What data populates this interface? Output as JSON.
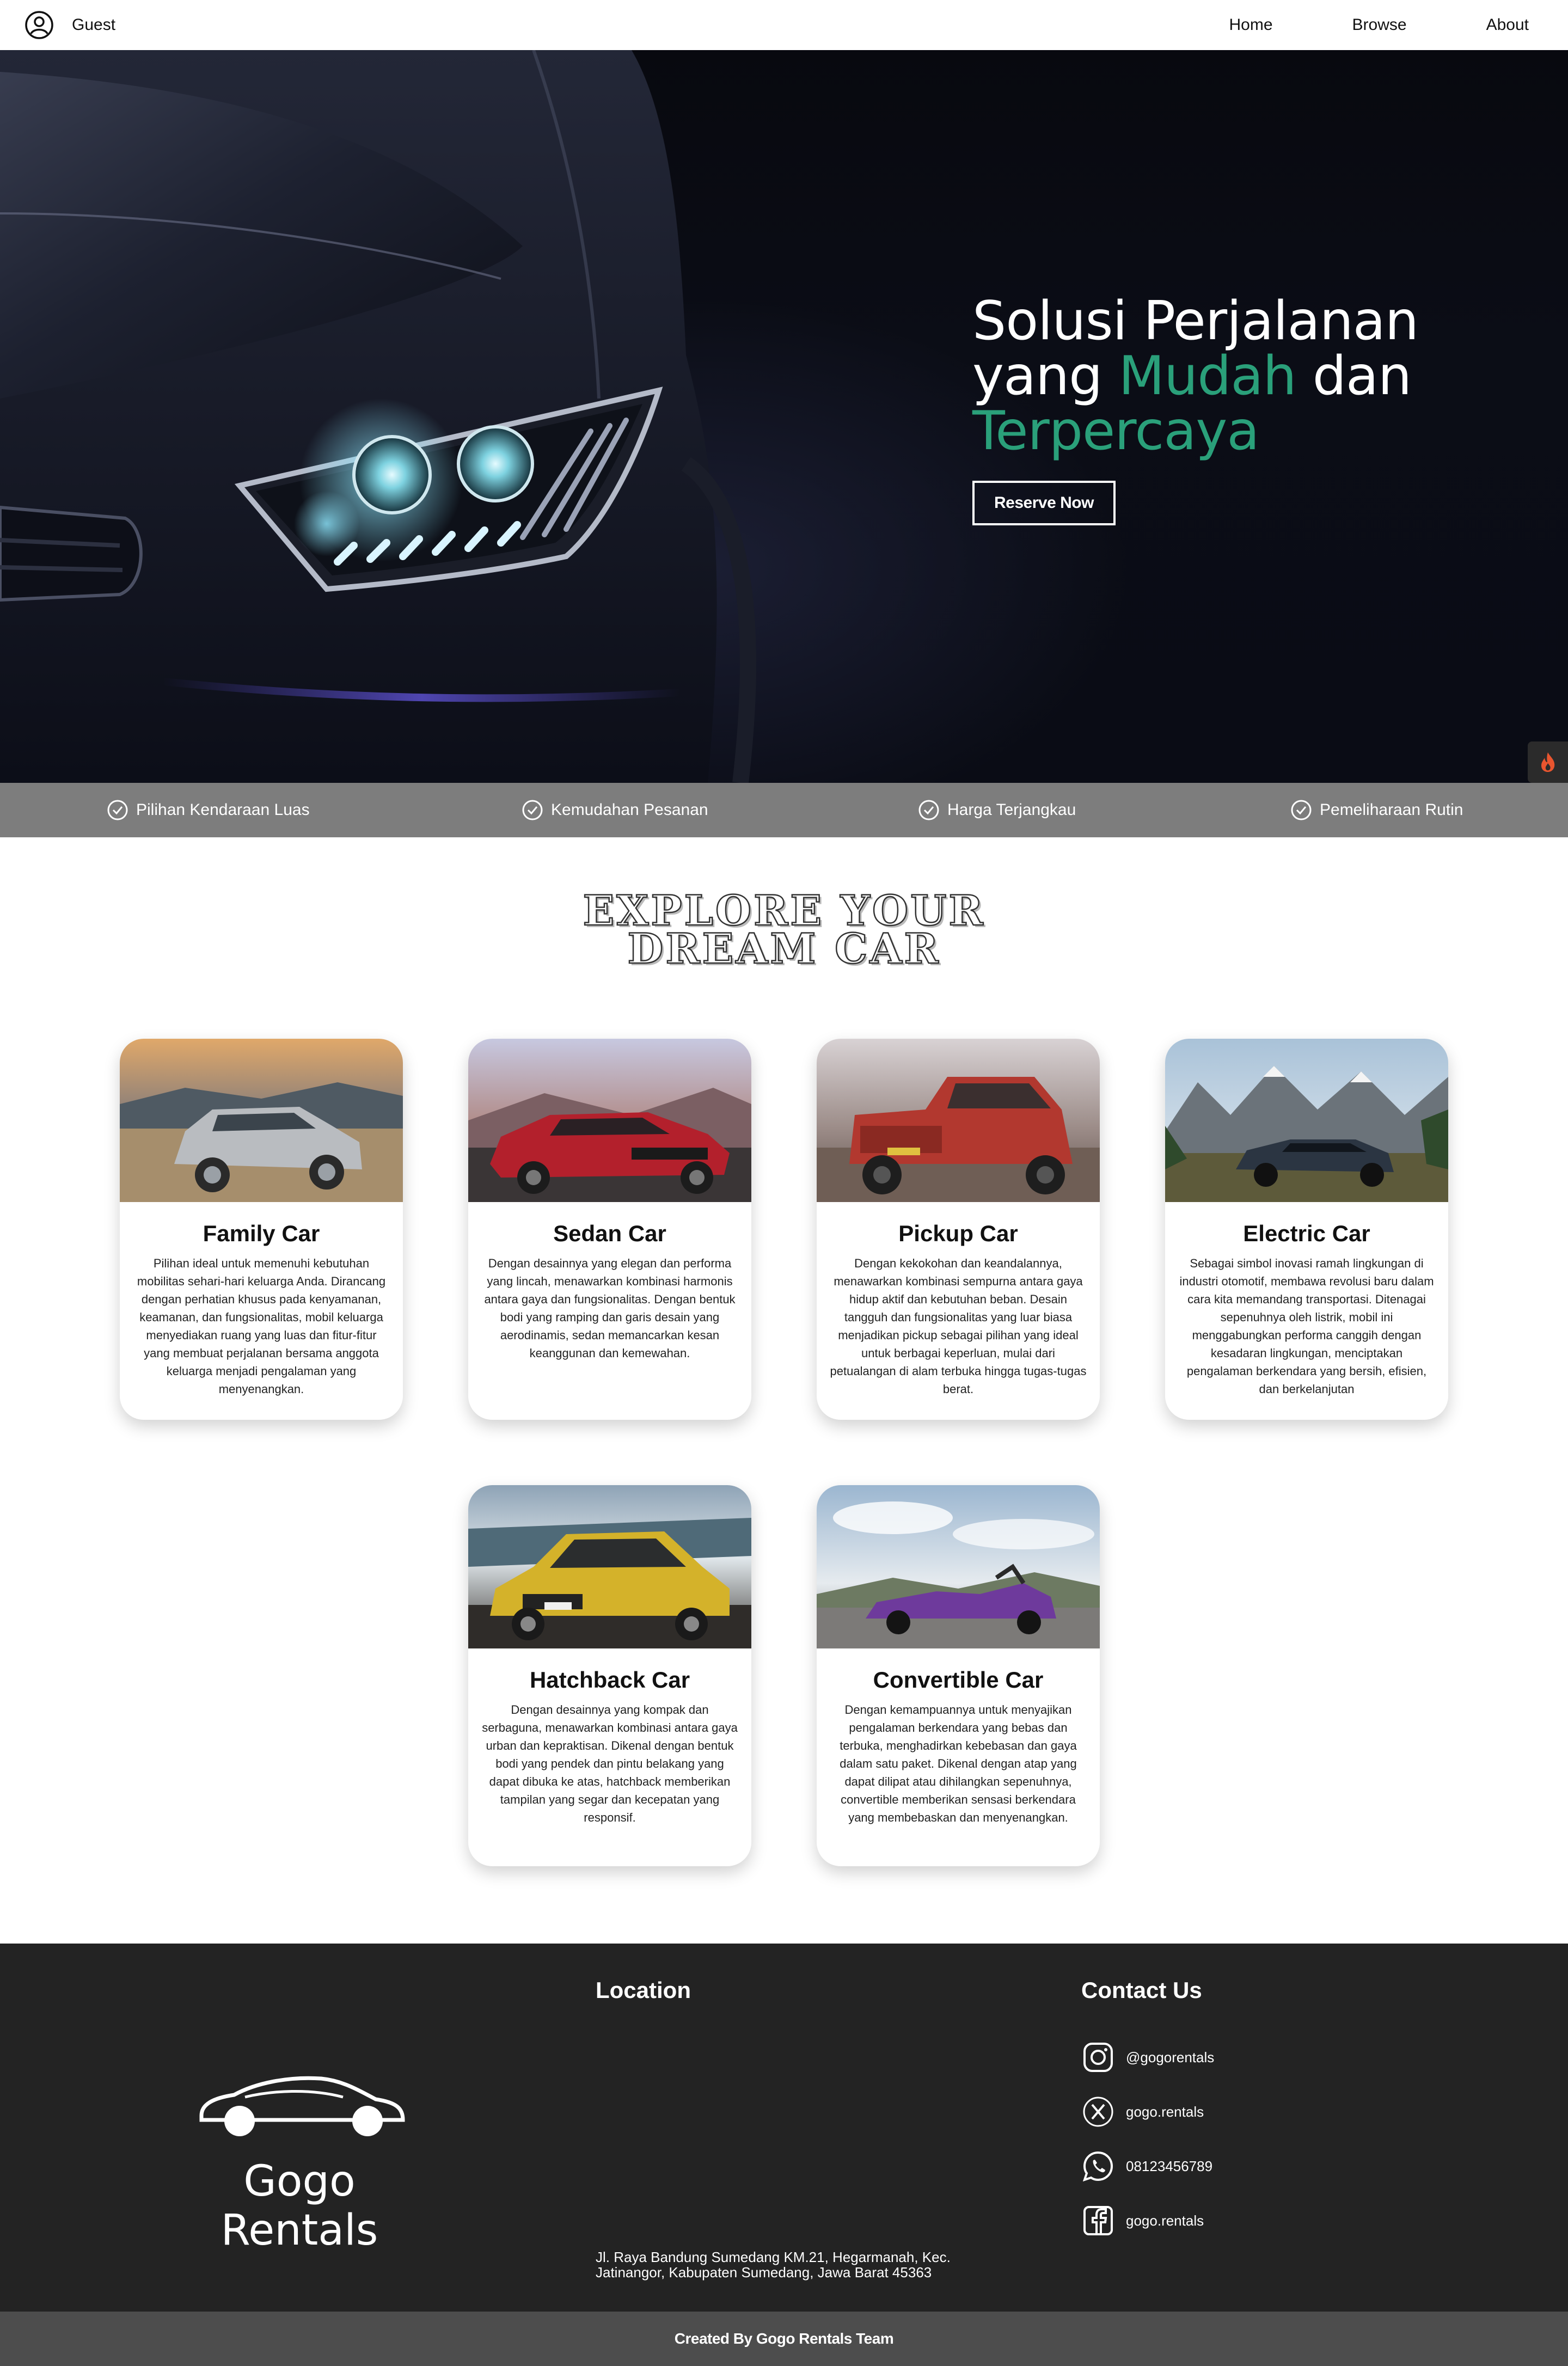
{
  "nav": {
    "user_icon": "user-circle-icon",
    "guest_label": "Guest",
    "links": [
      "Home",
      "Browse",
      "About"
    ]
  },
  "hero": {
    "title_line1": "Solusi Perjalanan",
    "title_line2_a": "yang ",
    "title_line2_accent": "Mudah",
    "title_line2_b": " dan",
    "title_line3_accent": "Terpercaya",
    "cta_label": "Reserve Now",
    "accent_color": "#2aa07a"
  },
  "features": [
    "Pilihan Kendaraan Luas",
    "Kemudahan Pesanan",
    "Harga Terjangkau",
    "Pemeliharaan Rutin"
  ],
  "explore": {
    "title_line1": "EXPLORE YOUR",
    "title_line2": "DREAM CAR"
  },
  "cards": [
    {
      "title": "Family Car",
      "desc": "Pilihan ideal untuk memenuhi kebutuhan mobilitas sehari-hari keluarga Anda. Dirancang dengan perhatian khusus pada kenyamanan, keamanan, dan fungsionalitas, mobil keluarga menyediakan ruang yang luas dan fitur-fitur yang membuat perjalanan bersama anggota keluarga menjadi pengalaman yang menyenangkan."
    },
    {
      "title": "Sedan Car",
      "desc": "Dengan desainnya yang elegan dan performa yang lincah, menawarkan kombinasi harmonis antara gaya dan fungsionalitas. Dengan bentuk bodi yang ramping dan garis desain yang aerodinamis, sedan memancarkan kesan keanggunan dan kemewahan."
    },
    {
      "title": "Pickup Car",
      "desc": "Dengan kekokohan dan keandalannya, menawarkan kombinasi sempurna antara gaya hidup aktif dan kebutuhan beban. Desain tangguh dan fungsionalitas yang luar biasa menjadikan pickup sebagai pilihan yang ideal untuk berbagai keperluan, mulai dari petualangan di alam terbuka hingga tugas-tugas berat."
    },
    {
      "title": "Electric Car",
      "desc": "Sebagai simbol inovasi ramah lingkungan di industri otomotif, membawa revolusi baru dalam cara kita memandang transportasi. Ditenagai sepenuhnya oleh listrik, mobil ini menggabungkan performa canggih dengan kesadaran lingkungan, menciptakan pengalaman berkendara yang bersih, efisien, dan berkelanjutan"
    },
    {
      "title": "Hatchback Car",
      "desc": "Dengan desainnya yang kompak dan serbaguna, menawarkan kombinasi antara gaya urban dan kepraktisan. Dikenal dengan bentuk bodi yang pendek dan pintu belakang yang dapat dibuka ke atas, hatchback memberikan tampilan yang segar dan kecepatan yang responsif."
    },
    {
      "title": "Convertible Car",
      "desc": "Dengan kemampuannya untuk menyajikan pengalaman berkendara yang bebas dan terbuka, menghadirkan kebebasan dan gaya dalam satu paket. Dikenal dengan atap yang dapat dilipat atau dihilangkan sepenuhnya, convertible memberikan sensasi berkendara yang membebaskan dan menyenangkan."
    }
  ],
  "footer": {
    "brand": "Gogo Rentals",
    "location_title": "Location",
    "address_line1": "Jl. Raya Bandung Sumedang KM.21, Hegarmanah, Kec.",
    "address_line2": "Jatinangor, Kabupaten Sumedang, Jawa Barat 45363",
    "contact_title": "Contact Us",
    "contacts": [
      {
        "icon": "instagram-icon",
        "label": "@gogorentals"
      },
      {
        "icon": "x-icon",
        "label": "gogo.rentals"
      },
      {
        "icon": "whatsapp-icon",
        "label": "08123456789"
      },
      {
        "icon": "facebook-icon",
        "label": "gogo.rentals"
      }
    ],
    "credit": "Created By Gogo Rentals Team"
  }
}
